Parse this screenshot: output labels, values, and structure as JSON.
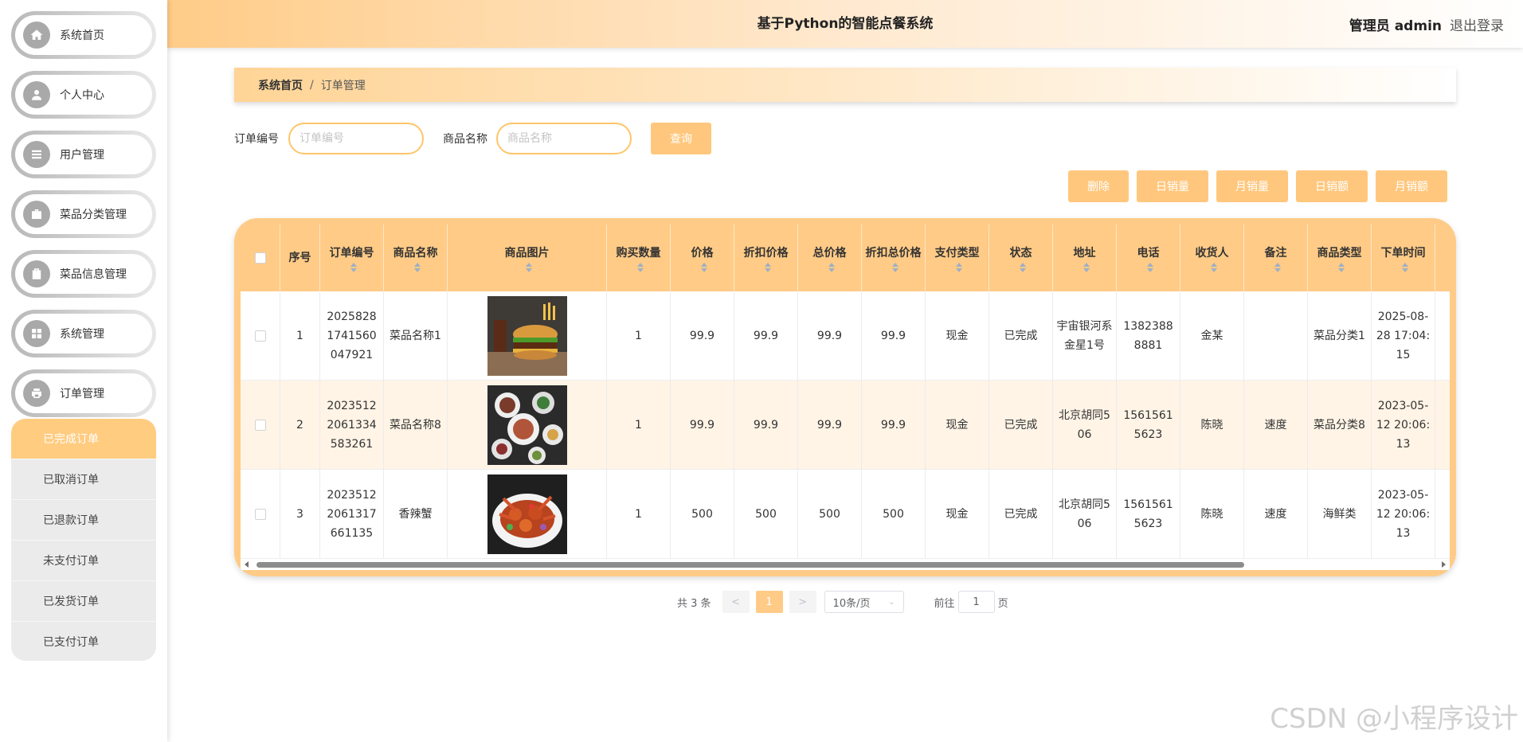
{
  "sidebar": {
    "items": [
      {
        "label": "系统首页",
        "icon": "home-icon"
      },
      {
        "label": "个人中心",
        "icon": "user-icon"
      },
      {
        "label": "用户管理",
        "icon": "list-icon"
      },
      {
        "label": "菜品分类管理",
        "icon": "briefcase-icon"
      },
      {
        "label": "菜品信息管理",
        "icon": "clipboard-icon"
      },
      {
        "label": "系统管理",
        "icon": "grid-icon"
      },
      {
        "label": "订单管理",
        "icon": "printer-icon"
      }
    ],
    "submenu": [
      {
        "label": "已完成订单",
        "active": true
      },
      {
        "label": "已取消订单"
      },
      {
        "label": "已退款订单"
      },
      {
        "label": "未支付订单"
      },
      {
        "label": "已发货订单"
      },
      {
        "label": "已支付订单"
      }
    ]
  },
  "header": {
    "title": "基于Python的智能点餐系统",
    "admin": "管理员 admin",
    "logout": "退出登录"
  },
  "breadcrumb": {
    "home": "系统首页",
    "sep": "/",
    "current": "订单管理"
  },
  "search": {
    "order_no_label": "订单编号",
    "order_no_placeholder": "订单编号",
    "product_label": "商品名称",
    "product_placeholder": "商品名称",
    "query_button": "查询"
  },
  "actions": [
    "删除",
    "日销量",
    "月销量",
    "日销额",
    "月销额"
  ],
  "table": {
    "columns": [
      "序号",
      "订单编号",
      "商品名称",
      "商品图片",
      "购买数量",
      "价格",
      "折扣价格",
      "总价格",
      "折扣总价格",
      "支付类型",
      "状态",
      "地址",
      "电话",
      "收货人",
      "备注",
      "商品类型",
      "下单时间"
    ],
    "rows": [
      {
        "idx": "1",
        "order_no": "20258281741560047921",
        "product": "菜品名称1",
        "image": "burger-photo",
        "qty": "1",
        "price": "99.9",
        "discount_price": "99.9",
        "total": "99.9",
        "discount_total": "99.9",
        "pay_type": "现金",
        "status": "已完成",
        "address": "宇宙银河系金星1号",
        "phone": "13823888881",
        "receiver": "金某",
        "remark": "",
        "category": "菜品分类1",
        "time": "2025-08-28 17:04:15"
      },
      {
        "idx": "2",
        "order_no": "20235122061334583261",
        "product": "菜品名称8",
        "image": "dishes-photo",
        "qty": "1",
        "price": "99.9",
        "discount_price": "99.9",
        "total": "99.9",
        "discount_total": "99.9",
        "pay_type": "现金",
        "status": "已完成",
        "address": "北京胡同506",
        "phone": "15615615623",
        "receiver": "陈晓",
        "remark": "速度",
        "category": "菜品分类8",
        "time": "2023-05-12 20:06:13"
      },
      {
        "idx": "3",
        "order_no": "20235122061317661135",
        "product": "香辣蟹",
        "image": "crab-photo",
        "qty": "1",
        "price": "500",
        "discount_price": "500",
        "total": "500",
        "discount_total": "500",
        "pay_type": "现金",
        "status": "已完成",
        "address": "北京胡同506",
        "phone": "15615615623",
        "receiver": "陈晓",
        "remark": "速度",
        "category": "海鲜类",
        "time": "2023-05-12 20:06:13"
      }
    ]
  },
  "pagination": {
    "total": "共 3 条",
    "prev": "<",
    "current_page": "1",
    "next": ">",
    "page_size": "10条/页",
    "goto_label": "前往",
    "goto_value": "1",
    "page_suffix": "页"
  },
  "watermark": "CSDN @小程序设计",
  "colors": {
    "accent": "#ffcb87",
    "button": "#ffc77d",
    "row_alt": "#fff4e6"
  }
}
